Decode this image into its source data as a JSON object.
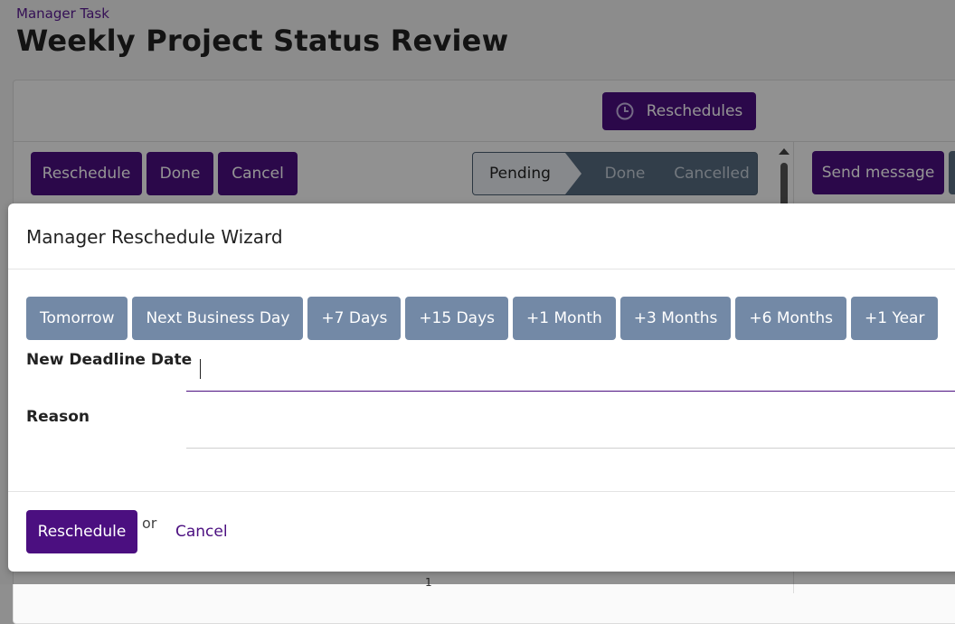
{
  "page": {
    "breadcrumb": "Manager Task",
    "title": "Weekly Project Status Review"
  },
  "toolbar": {
    "reschedules_label": "Reschedules",
    "reschedule_label": "Reschedule",
    "done_label": "Done",
    "cancel_label": "Cancel",
    "send_message_label": "Send message"
  },
  "status": {
    "stages": [
      "Pending",
      "Done",
      "Cancelled"
    ],
    "current": "Pending"
  },
  "modal": {
    "title": "Manager Reschedule Wizard",
    "quick_options": [
      "Tomorrow",
      "Next Business Day",
      "+7 Days",
      "+15 Days",
      "+1 Month",
      "+3 Months",
      "+6 Months",
      "+1 Year"
    ],
    "fields": {
      "deadline_label": "New Deadline Date",
      "deadline_value": "",
      "reason_label": "Reason",
      "reason_value": ""
    },
    "footer": {
      "submit_label": "Reschedule",
      "or_text": "or",
      "cancel_label": "Cancel"
    }
  },
  "stray_text": "1",
  "colors": {
    "brand": "#4b0f80",
    "quick_button": "#7389a6",
    "status_bar": "#566b80"
  }
}
